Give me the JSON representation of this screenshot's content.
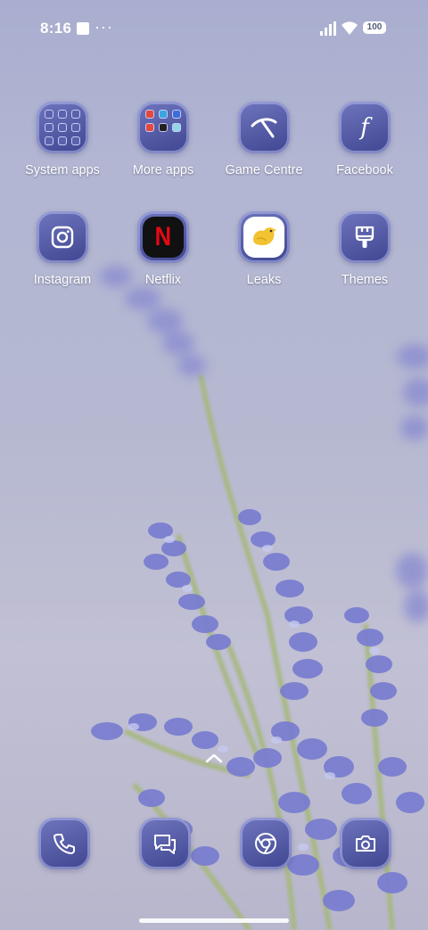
{
  "status_bar": {
    "time": "8:16",
    "overflow": "···",
    "battery": "100"
  },
  "apps": [
    {
      "label": "System apps",
      "icon": "folder-icon"
    },
    {
      "label": "More apps",
      "icon": "folder-icon"
    },
    {
      "label": "Game Centre",
      "icon": "game-centre-icon"
    },
    {
      "label": "Facebook",
      "icon": "facebook-icon"
    },
    {
      "label": "Instagram",
      "icon": "instagram-icon"
    },
    {
      "label": "Netflix",
      "icon": "netflix-icon"
    },
    {
      "label": "Leaks",
      "icon": "bird-icon"
    },
    {
      "label": "Themes",
      "icon": "paintbrush-icon"
    }
  ],
  "dock": [
    {
      "name": "phone",
      "icon": "phone-icon"
    },
    {
      "name": "messages",
      "icon": "messages-icon"
    },
    {
      "name": "browser",
      "icon": "chrome-icon"
    },
    {
      "name": "camera",
      "icon": "camera-icon"
    }
  ],
  "colors": {
    "icon_bg": "#4a50a0",
    "netflix_red": "#e50914",
    "leaks_yellow": "#f2c230"
  }
}
